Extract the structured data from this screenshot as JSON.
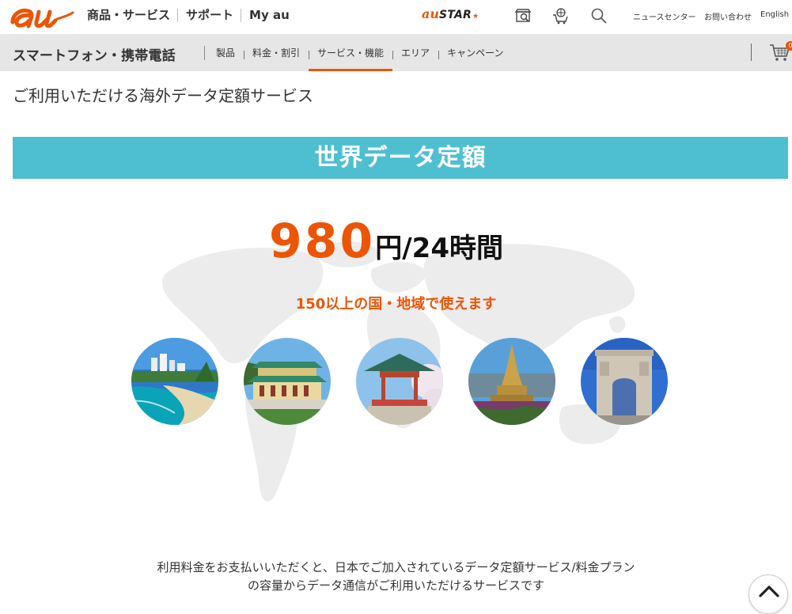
{
  "header": {
    "logo_text": "au",
    "nav": [
      {
        "label": "商品・サービス"
      },
      {
        "label": "サポート"
      },
      {
        "label": "My au"
      }
    ],
    "austar": {
      "prefix": "au",
      "label": "STAR",
      "mark": "★"
    },
    "icons": [
      "shop-search-icon",
      "globe-cart-icon",
      "search-icon"
    ],
    "utility": {
      "news": "ニュースセンター",
      "contact": "お問い合わせ",
      "english": "English"
    }
  },
  "subnav": {
    "title": "スマートフォン・携帯電話",
    "items": [
      {
        "label": "製品",
        "active": false
      },
      {
        "label": "料金・割引",
        "active": false
      },
      {
        "label": "サービス・機能",
        "active": true
      },
      {
        "label": "エリア",
        "active": false
      },
      {
        "label": "キャンペーン",
        "active": false
      }
    ],
    "cart_icon": "cart-icon",
    "cart_badge": "0"
  },
  "main": {
    "heading": "ご利用いただける海外データ定額サービス",
    "banner": "世界データ定額",
    "price_number": "980",
    "price_unit": "円/24時間",
    "tagline": "150以上の国・地域で使えます",
    "destinations": [
      "beach-resort-photo",
      "pagoda-temple-photo",
      "korean-pavilion-photo",
      "thai-stupa-photo",
      "arc-de-triomphe-photo"
    ],
    "description_line1": "利用料金をお支払いいただくと、日本でご加入されているデータ定額サービス/料金プラン",
    "description_line2": "の容量からデータ通信がご利用いただけるサービスです"
  },
  "colors": {
    "brand_orange": "#eb5505",
    "banner_teal": "#4ebfd1",
    "subnav_gray": "#e6e6e6"
  }
}
